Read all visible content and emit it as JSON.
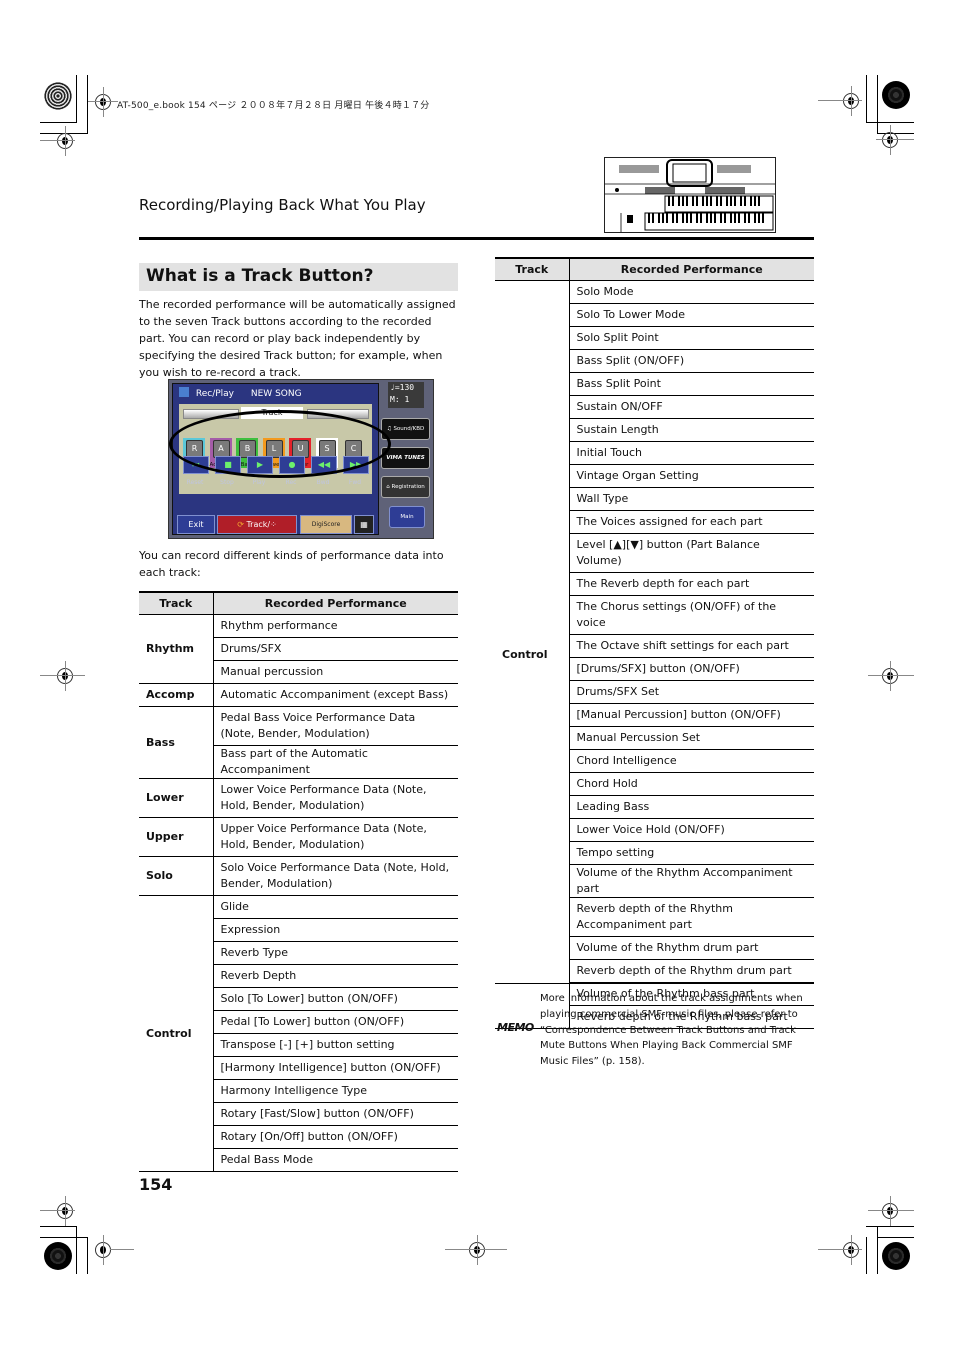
{
  "print_info": {
    "bookline": "AT-500_e.book  154 ページ  ２００８年７月２８日  月曜日  午後４時１７分"
  },
  "header": {
    "running_head": "Recording/Playing Back What You Play",
    "thumbnail_icon": "organ-keyboard-thumbnail"
  },
  "section": {
    "title": "What is a Track Button?",
    "intro": "The recorded performance will be automatically assigned to the seven Track buttons according to the recorded part. You can record or play back independently by specifying the desired Track button; for example, when you wish to re-record a track.",
    "lead_in": "You can record different kinds of performance data into each track:"
  },
  "lcd": {
    "mode": "Rec/Play",
    "song": "NEW SONG",
    "track_label": "Track",
    "tempo": "♩=130",
    "measure": "M:   1",
    "tracks": [
      {
        "key": "R",
        "label": "Rhythm",
        "color": "#5bc8d8"
      },
      {
        "key": "A",
        "label": "Accomp",
        "color": "#a45ca8"
      },
      {
        "key": "B",
        "label": "Bass",
        "color": "#3fbf3f"
      },
      {
        "key": "L",
        "label": "Lower",
        "color": "#f39a1e"
      },
      {
        "key": "U",
        "label": "Upper",
        "color": "#e4222a"
      },
      {
        "key": "S",
        "label": "Solo",
        "color": "#ffffff"
      },
      {
        "key": "C",
        "label": "Control",
        "color": "#c8c8a8"
      }
    ],
    "transport": [
      {
        "glyph": "⏮",
        "label": "Reset"
      },
      {
        "glyph": "■",
        "label": "Stop"
      },
      {
        "glyph": "▶",
        "label": "Play"
      },
      {
        "glyph": "●",
        "label": "Rec"
      },
      {
        "glyph": "◀◀",
        "label": "Bwd"
      },
      {
        "glyph": "▶▶",
        "label": "Fwd"
      }
    ],
    "exit_label": "Exit",
    "track_mute_label": "Track/",
    "digiscore_label": "DigiScore",
    "side_buttons": [
      "♫ Sound/KBD",
      "VIMA TUNES",
      "⌂ Registration",
      "Main"
    ]
  },
  "table_left": {
    "headers": [
      "Track",
      "Recorded Performance"
    ],
    "groups": [
      {
        "track": "Rhythm",
        "rows": [
          "Rhythm performance",
          "Drums/SFX",
          "Manual percussion"
        ]
      },
      {
        "track": "Accomp",
        "rows": [
          "Automatic Accompaniment (except Bass)"
        ]
      },
      {
        "track": "Bass",
        "rows": [
          "Pedal Bass Voice Performance Data (Note, Bender, Modulation)",
          "Bass part of the Automatic Accompaniment"
        ]
      },
      {
        "track": "Lower",
        "rows": [
          "Lower Voice Performance Data (Note, Hold, Bender, Modulation)"
        ]
      },
      {
        "track": "Upper",
        "rows": [
          "Upper Voice Performance Data (Note, Hold, Bender, Modulation)"
        ]
      },
      {
        "track": "Solo",
        "rows": [
          "Solo Voice Performance Data (Note, Hold, Bender, Modulation)"
        ]
      },
      {
        "track": "Control",
        "rows": [
          "Glide",
          "Expression",
          "Reverb Type",
          "Reverb Depth",
          "Solo [To Lower] button (ON/OFF)",
          "Pedal [To Lower] button (ON/OFF)",
          "Transpose [-] [+] button setting",
          "[Harmony Intelligence] button (ON/OFF)",
          "Harmony Intelligence Type",
          "Rotary [Fast/Slow] button (ON/OFF)",
          "Rotary [On/Off] button (ON/OFF)",
          "Pedal Bass Mode"
        ]
      }
    ]
  },
  "table_right": {
    "headers": [
      "Track",
      "Recorded Performance"
    ],
    "groups": [
      {
        "track": "Control",
        "rows": [
          "Solo Mode",
          "Solo To Lower Mode",
          "Solo Split Point",
          "Bass Split (ON/OFF)",
          "Bass Split Point",
          "Sustain ON/OFF",
          "Sustain Length",
          "Initial Touch",
          "Vintage Organ Setting",
          "Wall Type",
          "The Voices assigned for each part",
          "Level [▲][▼] button (Part Balance Volume)",
          "The Reverb depth for each part",
          "The Chorus settings (ON/OFF) of the voice",
          "The Octave shift settings for each part",
          "[Drums/SFX] button (ON/OFF)",
          "Drums/SFX Set",
          "[Manual Percussion] button (ON/OFF)",
          "Manual Percussion Set",
          "Chord Intelligence",
          "Chord Hold",
          "Leading Bass",
          "Lower Voice Hold (ON/OFF)",
          "Tempo setting",
          "Volume of the Rhythm Accompaniment part",
          "Reverb depth of the Rhythm Accompaniment part",
          "Volume of the Rhythm drum part",
          "Reverb depth of the Rhythm drum part",
          "Volume of the Rhythm bass part",
          "Reverb depth of the Rhythm bass part"
        ]
      }
    ]
  },
  "memo": {
    "icon_label": "MEMO",
    "text": "More information about the track assignments when playing commercial SMF music files, please refer to “Correspondence Between Track Buttons and Track Mute Buttons When Playing Back Commercial SMF Music Files” (p. 158)."
  },
  "footer": {
    "page_number": "154"
  }
}
